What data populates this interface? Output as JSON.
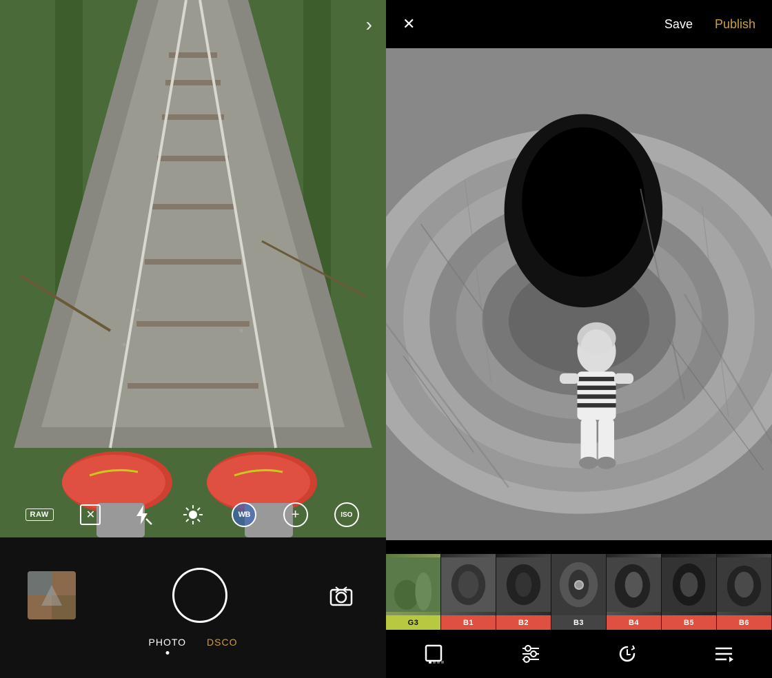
{
  "left_panel": {
    "controls": {
      "raw_label": "RAW",
      "wb_label": "WB",
      "iso_label": "ISO",
      "next_arrow": "›"
    },
    "modes": [
      {
        "label": "PHOTO",
        "active": true
      },
      {
        "label": "DSCO",
        "active": false
      }
    ],
    "bottom": {
      "shutter_label": "",
      "flip_label": "⇄"
    }
  },
  "right_panel": {
    "header": {
      "close_label": "✕",
      "save_label": "Save",
      "publish_label": "Publish"
    },
    "filters": [
      {
        "id": "g3",
        "label": "G3",
        "style": "active-g3"
      },
      {
        "id": "b1",
        "label": "B1",
        "style": "active-b1"
      },
      {
        "id": "b2",
        "label": "B2",
        "style": "active-b2"
      },
      {
        "id": "b3",
        "label": "B3",
        "style": "active-b3 filter-b3"
      },
      {
        "id": "b4",
        "label": "B4",
        "style": "active-b4"
      },
      {
        "id": "b5",
        "label": "B5",
        "style": "active-b5"
      },
      {
        "id": "b6",
        "label": "B6",
        "style": "active-b6"
      }
    ],
    "toolbar": {
      "frames_label": "frames",
      "adjust_label": "adjust",
      "history_label": "history",
      "layers_label": "layers"
    }
  }
}
